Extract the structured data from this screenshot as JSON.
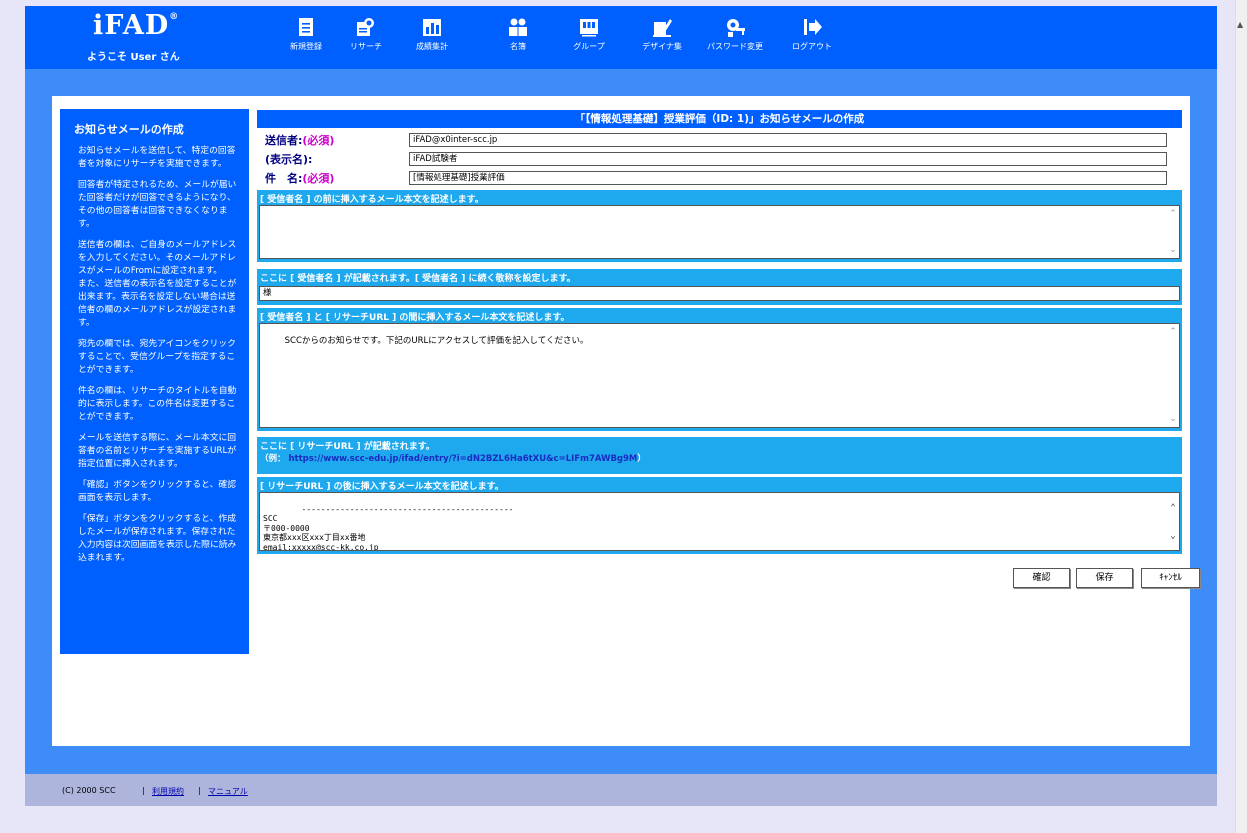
{
  "header": {
    "logo": "iFAD",
    "logo_mark": "®",
    "welcome": "ようこそ User さん",
    "nav": [
      {
        "label": "新規登録",
        "icon": "document-icon"
      },
      {
        "label": "リサーチ",
        "icon": "research-icon"
      },
      {
        "label": "成績集計",
        "icon": "grades-icon"
      },
      {
        "label": "名簿",
        "icon": "roster-icon"
      },
      {
        "label": "グループ",
        "icon": "group-icon"
      },
      {
        "label": "デザイナ集",
        "icon": "designer-icon"
      },
      {
        "label": "パスワード変更",
        "icon": "key-icon"
      },
      {
        "label": "ログアウト",
        "icon": "logout-icon"
      }
    ]
  },
  "help": {
    "title": "お知らせメールの作成",
    "paragraphs": [
      "お知らせメールを送信して、特定の回答者を対象にリサーチを実施できます。",
      "回答者が特定されるため、メールが届いた回答者だけが回答できるようになり、その他の回答者は回答できなくなります。",
      "送信者の欄は、ご自身のメールアドレスを入力してください。そのメールアドレスがメールのFromに設定されます。\nまた、送信者の表示名を設定することが出来ます。表示名を設定しない場合は送信者の欄のメールアドレスが設定されます。",
      "宛先の欄では、宛先アイコンをクリックすることで、受信グループを指定することができます。",
      "件名の欄は、リサーチのタイトルを自動的に表示します。この件名は変更することができます。",
      "メールを送信する際に、メール本文に回答者の名前とリサーチを実施するURLが指定位置に挿入されます。",
      "「確認」ボタンをクリックすると、確認画面を表示します。",
      "「保存」ボタンをクリックすると、作成したメールが保存されます。保存された入力内容は次回画面を表示した際に読み込まれます。"
    ]
  },
  "form": {
    "title": "「【情報処理基礎】授業評価（ID: 1)」お知らせメールの作成",
    "sender_label": "送信者:",
    "sender_req": "(必須)",
    "sender_value": "iFAD@x0inter-scc.jp",
    "display_label": "(表示名):",
    "display_value": "iFAD試験者",
    "subject_label": "件　名:",
    "subject_req": "(必須)",
    "subject_value": "[情報処理基礎]授業評価",
    "sec1_head": "[ 受信者名 ] の前に挿入するメール本文を記述します。",
    "sec1_value": "",
    "sec2_head": "ここに [ 受信者名 ] が記載されます。[ 受信者名 ] に続く敬称を設定します。",
    "sec2_value": "様",
    "sec3_head": "[ 受信者名 ] と [ リサーチURL ] の間に挿入するメール本文を記述します。",
    "sec3_value": "SCCからのお知らせです。下記のURLにアクセスして評価を記入してください。",
    "sec4_head": "ここに [ リサーチURL ] が記載されます。",
    "sec4_example_prefix": "（例：",
    "sec4_example_url": "https://www.scc-edu.jp/ifad/entry/?i=dN2BZL6Ha6tXU&c=LIFm7AWBg9M",
    "sec4_example_suffix": "）",
    "sec5_head": "[ リサーチURL ] の後に挿入するメール本文を記述します。",
    "sec5_value": "--------------------------------------------\nSCC\n〒000-0000\n東京都xxx区xxx丁目xx番地\nemail:xxxxx@scc-kk.co.jp"
  },
  "buttons": {
    "confirm": "確認",
    "save": "保存",
    "cancel": "ｷｬﾝｾﾙ"
  },
  "footer": {
    "copyright": "(C) 2000 SCC",
    "sep": "|",
    "terms": "利用規約",
    "manual": "マニュアル"
  },
  "colors": {
    "header": "#0060ff",
    "frame": "#3d8cf7",
    "section": "#1ea8ee",
    "footer": "#adb5dd",
    "required": "#cc00cc",
    "label": "#000080"
  }
}
